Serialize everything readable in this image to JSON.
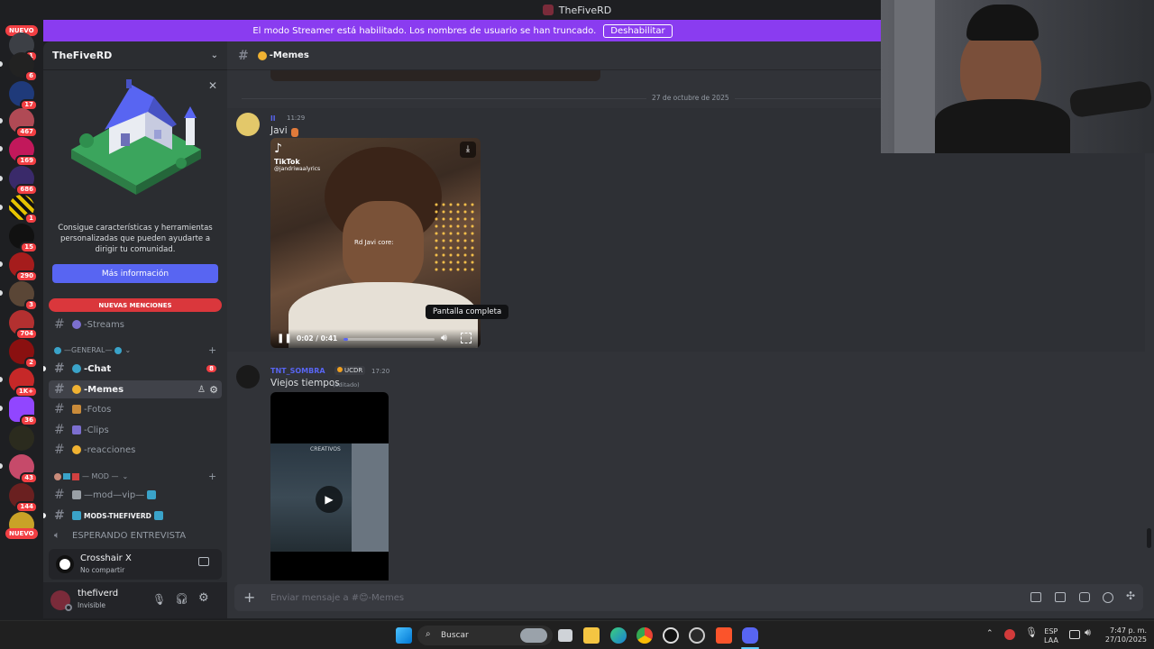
{
  "window": {
    "title": "TheFiveRD"
  },
  "banner": {
    "text": "El modo Streamer está habilitado. Los nombres de usuario se han truncado.",
    "button": "Deshabilitar"
  },
  "rail": {
    "new_top": "NUEVO",
    "new_bottom": "NUEVO",
    "badges": [
      "1",
      "6",
      "17",
      "467",
      "169",
      "686",
      "1",
      "15",
      "290",
      "3",
      "704",
      "2",
      "1K+",
      "36",
      "43",
      "144"
    ]
  },
  "server": {
    "name": "TheFiveRD"
  },
  "promo": {
    "text": "Consigue características y herramientas personalizadas que pueden ayudarte a dirigir tu comunidad.",
    "button": "Más información"
  },
  "mentions_label": "NUEVAS MENCIONES",
  "channels": {
    "streams": "-Streams",
    "cat_general": "—GENERAL—",
    "chat": "-Chat",
    "chat_badge": "8",
    "memes": "-Memes",
    "fotos": "-Fotos",
    "clips": "-Clips",
    "reacciones": "-reacciones",
    "cat_mod": "— MOD —",
    "mod_vip": "—mod—vip—",
    "mods_fiverd": "MODS-THEFIVERD",
    "voice": "ESPERANDO ENTREVISTA"
  },
  "activity": {
    "name": "Crosshair X",
    "status": "No compartir"
  },
  "user": {
    "name": "thefiverd",
    "status": "Invisible"
  },
  "channel_header": "-Memes",
  "date_divider": "27 de octubre de 2025",
  "messages": [
    {
      "author": "ll",
      "time": "11:29",
      "text": "Javi",
      "video": {
        "watermark": "TikTok",
        "handle": "@jandriwaalyrics",
        "caption": "Rd Javi core:",
        "time": "0:02 / 0:41",
        "progress": 0.05,
        "tooltip": "Pantalla completa"
      }
    },
    {
      "author": "TNT_SOMBRA",
      "tag": "UCDR",
      "time": "17:20",
      "text": "Viejos tiempos",
      "edited": "(editado)",
      "video": {
        "watermark": "CREATIVOS"
      }
    }
  ],
  "composer": {
    "placeholder": "Enviar mensaje a #😊-Memes"
  },
  "taskbar": {
    "search": "Buscar",
    "lang1": "ESP",
    "lang2": "LAA",
    "time": "7:47 p. m.",
    "date": "27/10/2025"
  },
  "colors": {
    "accent": "#5865f2",
    "banner": "#8a3cf0",
    "alert": "#f23f43"
  }
}
